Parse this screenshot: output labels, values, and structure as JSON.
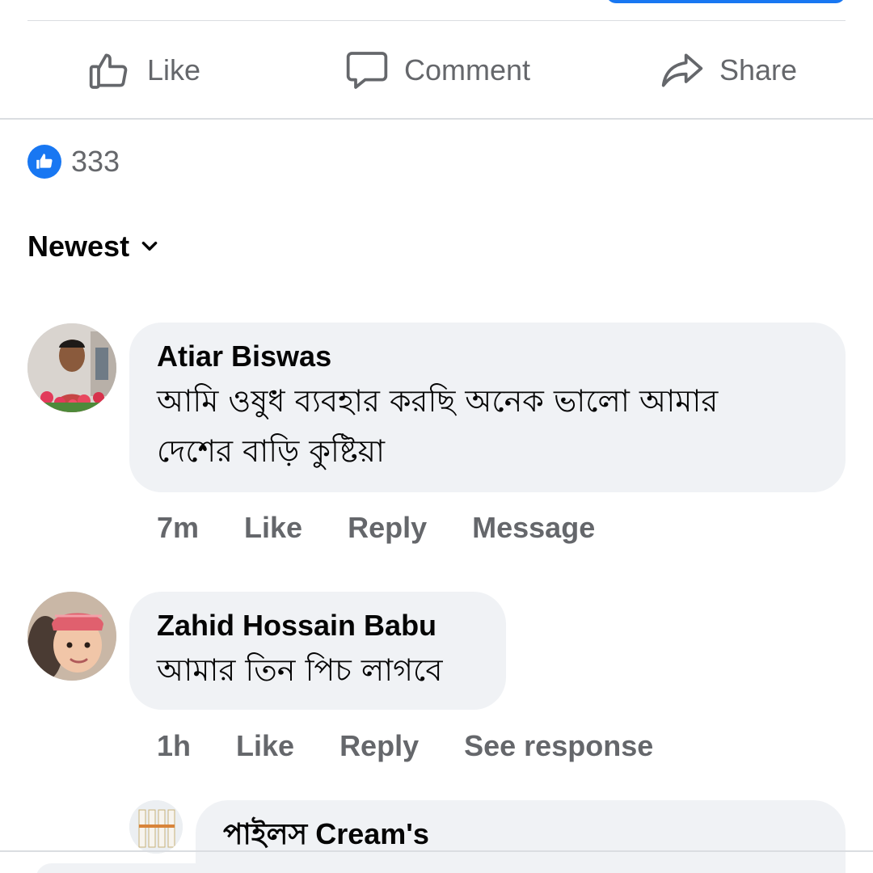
{
  "actions": {
    "like_label": "Like",
    "comment_label": "Comment",
    "share_label": "Share"
  },
  "reactions": {
    "count": "333",
    "icon": "thumbs-up-icon"
  },
  "sort": {
    "label": "Newest",
    "icon": "chevron-down-icon"
  },
  "comments": [
    {
      "author": "Atiar Biswas",
      "text_line1": "আমি ওষুধ ব্যবহার করছি অনেক ভালো আমার",
      "text_line2": "দেশের বাড়ি কুষ্টিয়া",
      "time": "7m",
      "like_label": "Like",
      "reply_label": "Reply",
      "extra_label": "Message"
    },
    {
      "author": "Zahid Hossain Babu",
      "text_line1": "আমার তিন পিচ লাগবে",
      "time": "1h",
      "like_label": "Like",
      "reply_label": "Reply",
      "extra_label": "See response"
    }
  ],
  "reply": {
    "author": "পাইলস Cream's"
  },
  "colors": {
    "accent": "#1877f2",
    "secondary_text": "#65676b",
    "bubble": "#f0f2f5"
  }
}
